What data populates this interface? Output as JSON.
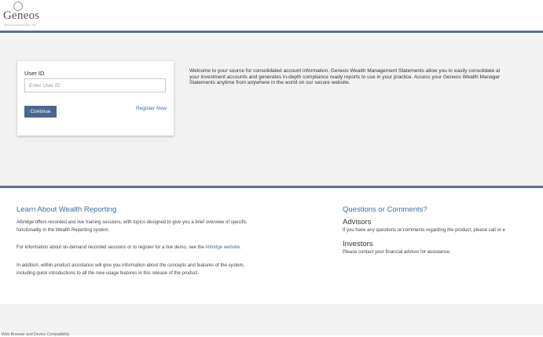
{
  "brand": {
    "name": "Geneos",
    "tagline": "WEALTH MANAGEMENT, INC."
  },
  "login": {
    "user_id_label": "User ID",
    "user_id_placeholder": "Enter User ID",
    "continue_label": "Continue",
    "register_label": "Register Now"
  },
  "welcome": {
    "line1": "Welcome to your source for consolidated account information. Geneos Wealth Management Statements allow you to easily consolidate al",
    "line2": "your investment accounts and generates in-depth compliance ready reports to use in your practice. Access your Geneos Wealth Manager",
    "line3": "Statements anytime from anywhere in the world on our secure website."
  },
  "learn": {
    "title": "Learn About Wealth Reporting",
    "p1_line1": "Albridge offers recorded and live training sessions, with topics designed to give you a brief overview of specific",
    "p1_line2": "functionality in the Wealth Reporting system.",
    "p2_text": "For information about on-demand recorded sessions or to register for a live demo, see the ",
    "p2_link": "Albridge website",
    "p2_end": ".",
    "p3_line1": "In addition, within-product assistance will give you information about the concepts and features of the system,",
    "p3_line2": "including quick introductions to all the new usage features in this release of the product."
  },
  "questions": {
    "title": "Questions or Comments?",
    "advisors_heading": "Advisors",
    "advisors_text": "If you have any questions or comments regarding the product, please call or e",
    "investors_heading": "Investors",
    "investors_text": "Please contact your financial advisor for assistance."
  },
  "footer": {
    "links_text": "Web Browser and Device Compatibility"
  },
  "colors": {
    "accent": "#4a6791",
    "stripe": "#5a6f8c",
    "link": "#3d6bb0",
    "heading": "#3f6da8"
  }
}
